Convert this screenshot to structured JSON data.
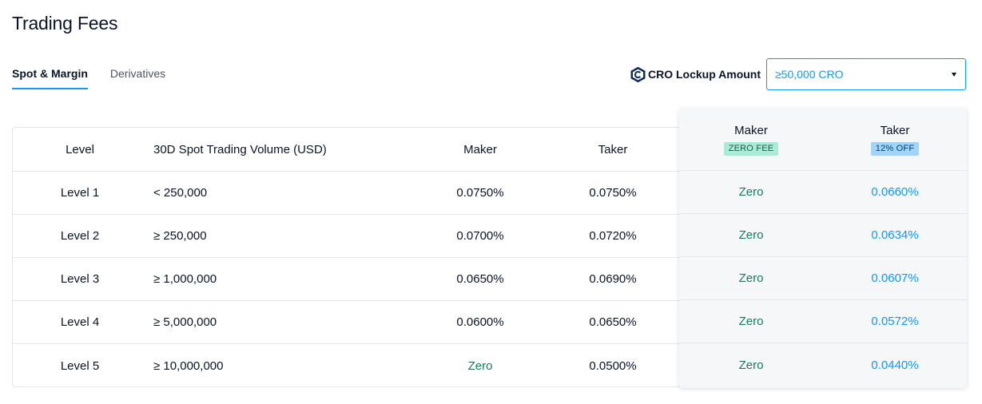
{
  "title": "Trading Fees",
  "tabs": [
    {
      "label": "Spot & Margin",
      "active": true
    },
    {
      "label": "Derivatives",
      "active": false
    }
  ],
  "lockup": {
    "icon": "cro-logo-icon",
    "label": "CRO Lockup Amount",
    "selected": "≥50,000 CRO"
  },
  "table": {
    "headers": {
      "level": "Level",
      "volume": "30D Spot Trading Volume (USD)",
      "maker": "Maker",
      "taker": "Taker"
    },
    "rows": [
      {
        "level": "Level 1",
        "volume": "< 250,000",
        "maker": "0.0750%",
        "taker": "0.0750%"
      },
      {
        "level": "Level 2",
        "volume": "≥ 250,000",
        "maker": "0.0700%",
        "taker": "0.0720%"
      },
      {
        "level": "Level 3",
        "volume": "≥ 1,000,000",
        "maker": "0.0650%",
        "taker": "0.0690%"
      },
      {
        "level": "Level 4",
        "volume": "≥ 5,000,000",
        "maker": "0.0600%",
        "taker": "0.0650%"
      },
      {
        "level": "Level 5",
        "volume": "≥ 10,000,000",
        "maker": "Zero",
        "taker": "0.0500%"
      }
    ]
  },
  "discount": {
    "headers": {
      "maker": "Maker",
      "maker_badge": "ZERO FEE",
      "taker": "Taker",
      "taker_badge": "12% OFF"
    },
    "rows": [
      {
        "maker": "Zero",
        "taker": "0.0660%"
      },
      {
        "maker": "Zero",
        "taker": "0.0634%"
      },
      {
        "maker": "Zero",
        "taker": "0.0607%"
      },
      {
        "maker": "Zero",
        "taker": "0.0572%"
      },
      {
        "maker": "Zero",
        "taker": "0.0440%"
      }
    ]
  },
  "colors": {
    "accent": "#1199fa",
    "zero_green": "#1c7a5c",
    "badge_green": "#a8ebd6",
    "badge_blue": "#9fd5fb"
  }
}
